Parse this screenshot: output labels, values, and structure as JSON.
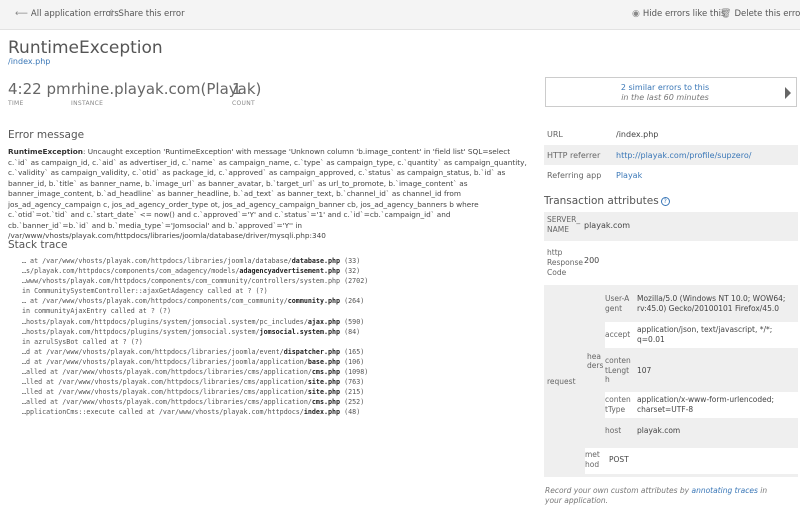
{
  "toolbar": {
    "back_label": "All application errors",
    "share_label": "Share this error",
    "hide_label": "Hide errors like this",
    "delete_label": "Delete this error"
  },
  "error": {
    "title": "RuntimeException",
    "path": "/index.php"
  },
  "stats": {
    "time": {
      "value": "4:22 pm",
      "label": "TIME"
    },
    "instance": {
      "value": "rhine.playak.com(Playak)",
      "label": "INSTANCE"
    },
    "count": {
      "value": "1",
      "label": "COUNT"
    }
  },
  "similar": {
    "line1": "2 similar errors to this",
    "line2": "in the last 60 minutes"
  },
  "error_message": {
    "heading": "Error message",
    "label": "RuntimeException",
    "text": ": Uncaught exception 'RuntimeException' with message 'Unknown column 'b.image_content' in 'field list' SQL=select c.`id` as campaign_id, c.`aid` as advertiser_id, c.`name` as campaign_name, c.`type` as campaign_type, c.`quantity` as campaign_quantity, c.`validity` as campaign_validity, c.`otid` as package_id, c.`approved` as campaign_approved, c.`status` as campaign_status, b.`id` as banner_id, b.`title` as banner_name, b.`image_url` as banner_avatar, b.`target_url` as url_to_promote, b.`image_content` as banner_image_content, b.`ad_headline` as banner_headline, b.`ad_text` as banner_text, b.`channel_id` as channel_id from jos_ad_agency_campaign c, jos_ad_agency_order_type ot, jos_ad_agency_campaign_banner cb, jos_ad_agency_banners b where c.`otid`=ot.`tid` and c.`start_date` <= now() and c.`approved`='Y' and c.`status`='1' and c.`id`=cb.`campaign_id` and cb.`banner_id`=b.`id` and b.`media_type`='Jomsocial' and b.`approved`='Y'' in /var/www/vhosts/playak.com/httpdocs/libraries/joomla/database/driver/mysqli.php:340"
  },
  "stack": {
    "heading": "Stack trace",
    "lines": [
      {
        "pre": "… at /var/www/vhosts/playak.com/httpdocs/libraries/joomla/database/",
        "file": "database.php",
        "post": " (33)"
      },
      {
        "pre": "…s/playak.com/httpdocs/components/com_adagency/models/",
        "file": "adagencyadvertisement.php",
        "post": " (32)"
      },
      {
        "pre": "…www/vhosts/playak.com/httpdocs/components/com_community/controllers/system.php (2702)",
        "file": "",
        "post": ""
      },
      {
        "pre": "in CommunitySystemController::ajaxGetAdagency called at ? (?)",
        "file": "",
        "post": ""
      },
      {
        "pre": "… at /var/www/vhosts/playak.com/httpdocs/components/com_community/",
        "file": "community.php",
        "post": " (264)"
      },
      {
        "pre": "in communityAjaxEntry called at ? (?)",
        "file": "",
        "post": ""
      },
      {
        "pre": "…hosts/playak.com/httpdocs/plugins/system/jomsocial.system/pc_includes/",
        "file": "ajax.php",
        "post": " (590)"
      },
      {
        "pre": "…hosts/playak.com/httpdocs/plugins/system/jomsocial.system/",
        "file": "jomsocial.system.php",
        "post": " (84)"
      },
      {
        "pre": "in azrulSysBot called at ? (?)",
        "file": "",
        "post": ""
      },
      {
        "pre": "…d at /var/www/vhosts/playak.com/httpdocs/libraries/joomla/event/",
        "file": "dispatcher.php",
        "post": " (165)"
      },
      {
        "pre": "…d at /var/www/vhosts/playak.com/httpdocs/libraries/joomla/application/",
        "file": "base.php",
        "post": " (106)"
      },
      {
        "pre": "…alled at /var/www/vhosts/playak.com/httpdocs/libraries/cms/application/",
        "file": "cms.php",
        "post": " (1098)"
      },
      {
        "pre": "…lled at /var/www/vhosts/playak.com/httpdocs/libraries/cms/application/",
        "file": "site.php",
        "post": " (763)"
      },
      {
        "pre": "…lled at /var/www/vhosts/playak.com/httpdocs/libraries/cms/application/",
        "file": "site.php",
        "post": " (215)"
      },
      {
        "pre": "…alled at /var/www/vhosts/playak.com/httpdocs/libraries/cms/application/",
        "file": "cms.php",
        "post": " (252)"
      },
      {
        "pre": "…pplicationCms::execute called at /var/www/vhosts/playak.com/httpdocs/",
        "file": "index.php",
        "post": " (48)"
      }
    ]
  },
  "details": {
    "url_label": "URL",
    "url_value": "/index.php",
    "referrer_label": "HTTP referrer",
    "referrer_value": "http://playak.com/profile/supzero/",
    "app_label": "Referring app",
    "app_value": "Playak"
  },
  "attributes": {
    "heading": "Transaction attributes",
    "server_name_key": "SERVER_ NAME",
    "server_name_val": "playak.com",
    "http_code_key": "http Response Code",
    "http_code_val": "200",
    "request_key": "request",
    "headers_key": "hea ders",
    "user_agent_key": "User-A gent",
    "user_agent_val": "Mozilla/5.0 (Windows NT 10.0; WOW64; rv:45.0) Gecko/20100101 Firefox/45.0",
    "accept_key": "accept",
    "accept_val": "application/json, text/javascript, */*; q=0.01",
    "content_length_key": "conten tLength",
    "content_length_val": "107",
    "content_type_key": "conten tType",
    "content_type_val": "application/x-www-form-urlencoded; charset=UTF-8",
    "host_key": "host",
    "host_val": "playak.com",
    "method_key": "met hod",
    "method_val": "POST"
  },
  "footnote": {
    "pre": "Record your own custom attributes by ",
    "link": "annotating traces",
    "post": " in your application."
  },
  "icons": {
    "back": "arrow-left-icon",
    "share": "share-icon",
    "hide": "eye-slash-icon",
    "delete": "trash-icon",
    "help": "help-circle-icon"
  },
  "colors": {
    "link": "#3a77b7",
    "shade": "#efefef"
  }
}
